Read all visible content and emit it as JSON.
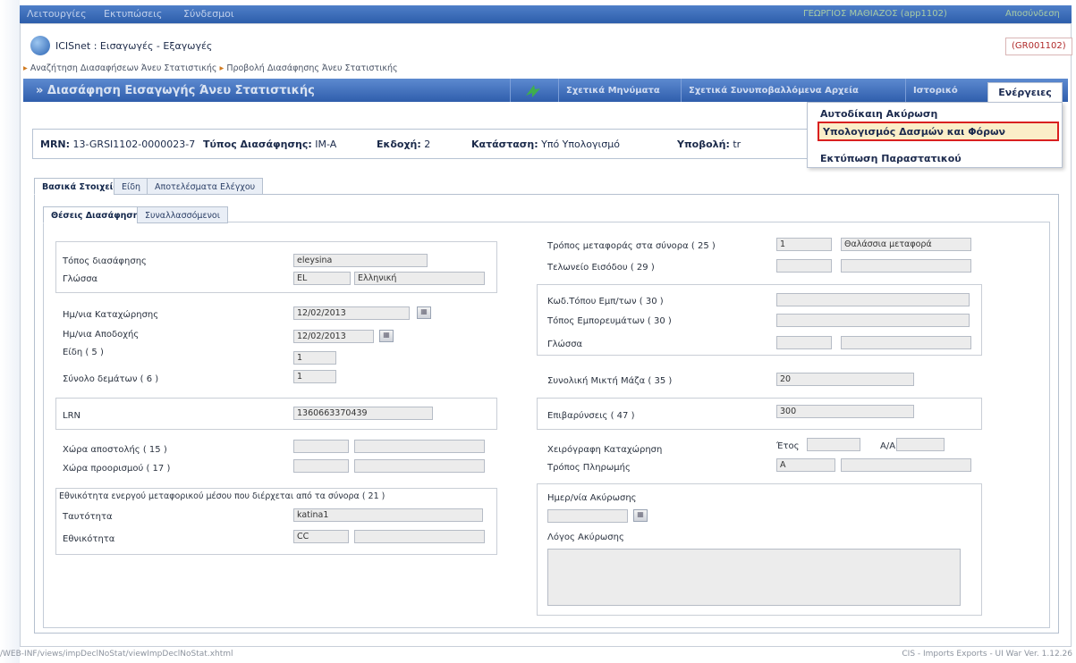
{
  "topbar": {
    "menus": [
      "Λειτουργίες",
      "Εκτυπώσεις",
      "Σύνδεσμοι"
    ],
    "user": "ΓΕΩΡΓΙΟΣ ΜΑΘΙΑΖΟΣ (app1102)",
    "logout": "Αποσύνδεση"
  },
  "app": {
    "title": "ICISnet : Εισαγωγές - Εξαγωγές",
    "code": "(GR001102)"
  },
  "breadcrumb": {
    "item1": "Αναζήτηση Διασαφήσεων Άνευ Στατιστικής",
    "item2": "Προβολή Διασάφησης Άνευ Στατιστικής"
  },
  "bluebar": {
    "title": "» Διασάφηση Εισαγωγής Άνευ Στατιστικής",
    "messages": "Σχετικά Μηνύματα",
    "files": "Σχετικά Συνυποβαλλόμενα Αρχεία",
    "history": "Ιστορικό",
    "actions": "Ενέργειες"
  },
  "dropdown": {
    "item1": "Αυτοδίκαιη Ακύρωση",
    "item2": "Υπολογισμός Δασμών και Φόρων",
    "item3": "Εκτύπωση Παραστατικού"
  },
  "mrn": {
    "mrn_label": "MRN:",
    "mrn_value": "13-GRSI1102-0000023-7",
    "type_label": "Τύπος Διασάφησης:",
    "type_value": "IM-A",
    "version_label": "Εκδοχή:",
    "version_value": "2",
    "status_label": "Κατάσταση:",
    "status_value": "Υπό Υπολογισμό",
    "submit_label": "Υποβολή:",
    "submit_value": "tr"
  },
  "tabs_main": [
    "Βασικά Στοιχεία",
    "Είδη",
    "Αποτελέσματα Ελέγχου"
  ],
  "tabs_sub": [
    "Θέσεις Διασάφησης",
    "Συναλλασσόμενοι"
  ],
  "left": {
    "place_label": "Τόπος διασάφησης",
    "place_value": "eleysina",
    "lang_label": "Γλώσσα",
    "lang_code": "EL",
    "lang_name": "Ελληνική",
    "reg_date_label": "Ημ/νια Καταχώρησης",
    "reg_date_value": "12/02/2013",
    "acc_date_label": "Ημ/νια Αποδοχής",
    "acc_date_value": "12/02/2013",
    "items_label": "Είδη ( 5 )",
    "items_value": "1",
    "packages_label": "Σύνολο δεμάτων ( 6 )",
    "packages_value": "1",
    "lrn_label": "LRN",
    "lrn_value": "1360663370439",
    "dispatch_label": "Χώρα αποστολής ( 15 )",
    "dest_label": "Χώρα προορισμού ( 17 )",
    "nat_group_label": "Εθνικότητα ενεργού μεταφορικού μέσου που διέρχεται από τα σύνορα ( 21 )",
    "identity_label": "Ταυτότητα",
    "identity_value": "katina1",
    "nationality_label": "Εθνικότητα",
    "nationality_value": "CC"
  },
  "right": {
    "transport_label": "Τρόπος μεταφοράς στα σύνορα ( 25 )",
    "transport_code": "1",
    "transport_name": "Θαλάσσια μεταφορά",
    "entry_office_label": "Τελωνείο Εισόδου ( 29 )",
    "goods_code_label": "Κωδ.Τόπου Εμπ/των ( 30 )",
    "goods_place_label": "Τόπος Εμπορευμάτων ( 30 )",
    "lang_label": "Γλώσσα",
    "gross_mass_label": "Συνολική Μικτή Μάζα ( 35 )",
    "gross_mass_value": "20",
    "charges_label": "Επιβαρύνσεις ( 47 )",
    "charges_value": "300",
    "manual_label": "Χειρόγραφη Καταχώρηση",
    "year_label": "Έτος",
    "aa_label": "Α/Α",
    "payment_label": "Τρόπος Πληρωμής",
    "payment_value": "A",
    "cancel_date_label": "Ημερ/νία Ακύρωσης",
    "cancel_reason_label": "Λόγος Ακύρωσης"
  },
  "status": {
    "path": "/WEB-INF/views/impDeclNoStat/viewImpDeclNoStat.xhtml",
    "version": "CIS - Imports Exports - UI War Ver. 1.12.26"
  }
}
